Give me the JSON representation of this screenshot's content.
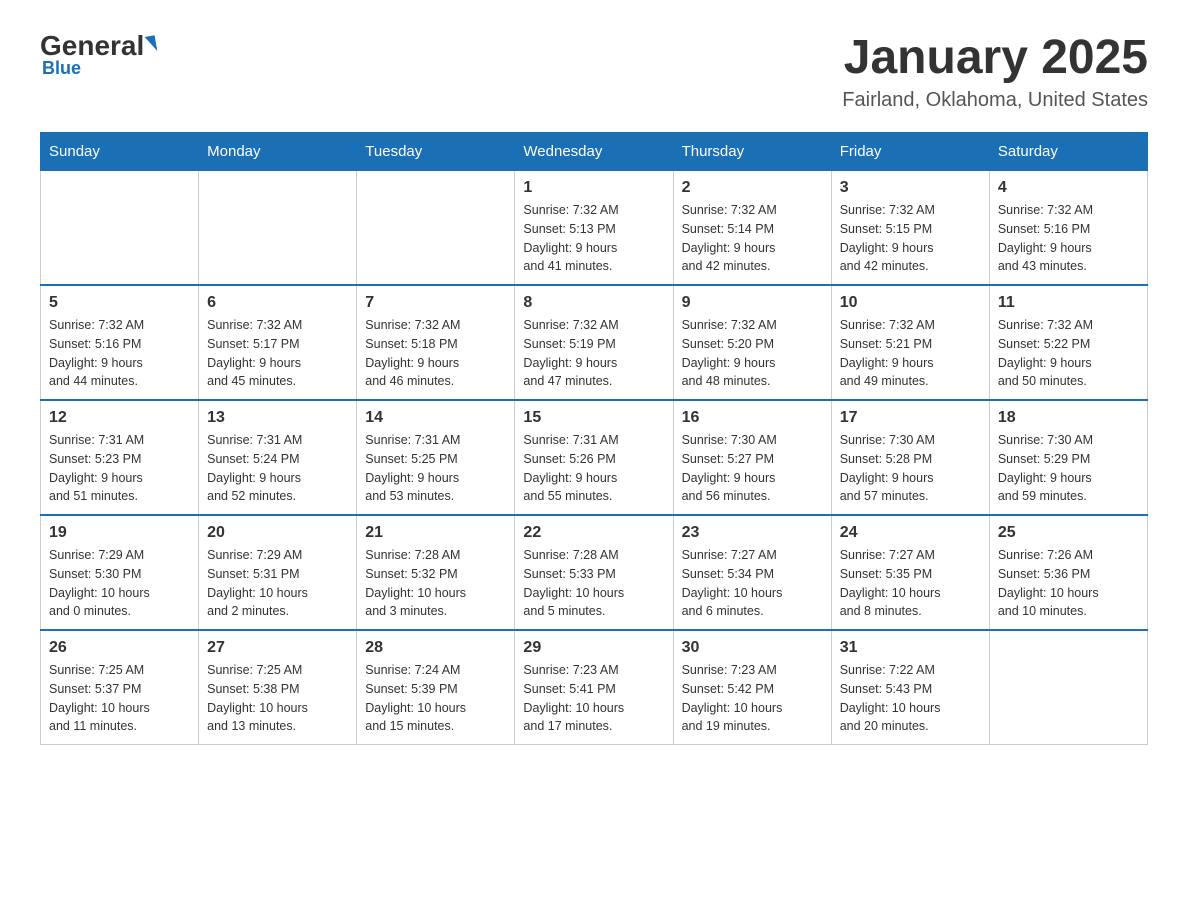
{
  "logo": {
    "general": "General",
    "triangle": "",
    "blue": "Blue"
  },
  "title": "January 2025",
  "subtitle": "Fairland, Oklahoma, United States",
  "weekdays": [
    "Sunday",
    "Monday",
    "Tuesday",
    "Wednesday",
    "Thursday",
    "Friday",
    "Saturday"
  ],
  "weeks": [
    [
      {
        "day": "",
        "info": ""
      },
      {
        "day": "",
        "info": ""
      },
      {
        "day": "",
        "info": ""
      },
      {
        "day": "1",
        "info": "Sunrise: 7:32 AM\nSunset: 5:13 PM\nDaylight: 9 hours\nand 41 minutes."
      },
      {
        "day": "2",
        "info": "Sunrise: 7:32 AM\nSunset: 5:14 PM\nDaylight: 9 hours\nand 42 minutes."
      },
      {
        "day": "3",
        "info": "Sunrise: 7:32 AM\nSunset: 5:15 PM\nDaylight: 9 hours\nand 42 minutes."
      },
      {
        "day": "4",
        "info": "Sunrise: 7:32 AM\nSunset: 5:16 PM\nDaylight: 9 hours\nand 43 minutes."
      }
    ],
    [
      {
        "day": "5",
        "info": "Sunrise: 7:32 AM\nSunset: 5:16 PM\nDaylight: 9 hours\nand 44 minutes."
      },
      {
        "day": "6",
        "info": "Sunrise: 7:32 AM\nSunset: 5:17 PM\nDaylight: 9 hours\nand 45 minutes."
      },
      {
        "day": "7",
        "info": "Sunrise: 7:32 AM\nSunset: 5:18 PM\nDaylight: 9 hours\nand 46 minutes."
      },
      {
        "day": "8",
        "info": "Sunrise: 7:32 AM\nSunset: 5:19 PM\nDaylight: 9 hours\nand 47 minutes."
      },
      {
        "day": "9",
        "info": "Sunrise: 7:32 AM\nSunset: 5:20 PM\nDaylight: 9 hours\nand 48 minutes."
      },
      {
        "day": "10",
        "info": "Sunrise: 7:32 AM\nSunset: 5:21 PM\nDaylight: 9 hours\nand 49 minutes."
      },
      {
        "day": "11",
        "info": "Sunrise: 7:32 AM\nSunset: 5:22 PM\nDaylight: 9 hours\nand 50 minutes."
      }
    ],
    [
      {
        "day": "12",
        "info": "Sunrise: 7:31 AM\nSunset: 5:23 PM\nDaylight: 9 hours\nand 51 minutes."
      },
      {
        "day": "13",
        "info": "Sunrise: 7:31 AM\nSunset: 5:24 PM\nDaylight: 9 hours\nand 52 minutes."
      },
      {
        "day": "14",
        "info": "Sunrise: 7:31 AM\nSunset: 5:25 PM\nDaylight: 9 hours\nand 53 minutes."
      },
      {
        "day": "15",
        "info": "Sunrise: 7:31 AM\nSunset: 5:26 PM\nDaylight: 9 hours\nand 55 minutes."
      },
      {
        "day": "16",
        "info": "Sunrise: 7:30 AM\nSunset: 5:27 PM\nDaylight: 9 hours\nand 56 minutes."
      },
      {
        "day": "17",
        "info": "Sunrise: 7:30 AM\nSunset: 5:28 PM\nDaylight: 9 hours\nand 57 minutes."
      },
      {
        "day": "18",
        "info": "Sunrise: 7:30 AM\nSunset: 5:29 PM\nDaylight: 9 hours\nand 59 minutes."
      }
    ],
    [
      {
        "day": "19",
        "info": "Sunrise: 7:29 AM\nSunset: 5:30 PM\nDaylight: 10 hours\nand 0 minutes."
      },
      {
        "day": "20",
        "info": "Sunrise: 7:29 AM\nSunset: 5:31 PM\nDaylight: 10 hours\nand 2 minutes."
      },
      {
        "day": "21",
        "info": "Sunrise: 7:28 AM\nSunset: 5:32 PM\nDaylight: 10 hours\nand 3 minutes."
      },
      {
        "day": "22",
        "info": "Sunrise: 7:28 AM\nSunset: 5:33 PM\nDaylight: 10 hours\nand 5 minutes."
      },
      {
        "day": "23",
        "info": "Sunrise: 7:27 AM\nSunset: 5:34 PM\nDaylight: 10 hours\nand 6 minutes."
      },
      {
        "day": "24",
        "info": "Sunrise: 7:27 AM\nSunset: 5:35 PM\nDaylight: 10 hours\nand 8 minutes."
      },
      {
        "day": "25",
        "info": "Sunrise: 7:26 AM\nSunset: 5:36 PM\nDaylight: 10 hours\nand 10 minutes."
      }
    ],
    [
      {
        "day": "26",
        "info": "Sunrise: 7:25 AM\nSunset: 5:37 PM\nDaylight: 10 hours\nand 11 minutes."
      },
      {
        "day": "27",
        "info": "Sunrise: 7:25 AM\nSunset: 5:38 PM\nDaylight: 10 hours\nand 13 minutes."
      },
      {
        "day": "28",
        "info": "Sunrise: 7:24 AM\nSunset: 5:39 PM\nDaylight: 10 hours\nand 15 minutes."
      },
      {
        "day": "29",
        "info": "Sunrise: 7:23 AM\nSunset: 5:41 PM\nDaylight: 10 hours\nand 17 minutes."
      },
      {
        "day": "30",
        "info": "Sunrise: 7:23 AM\nSunset: 5:42 PM\nDaylight: 10 hours\nand 19 minutes."
      },
      {
        "day": "31",
        "info": "Sunrise: 7:22 AM\nSunset: 5:43 PM\nDaylight: 10 hours\nand 20 minutes."
      },
      {
        "day": "",
        "info": ""
      }
    ]
  ]
}
